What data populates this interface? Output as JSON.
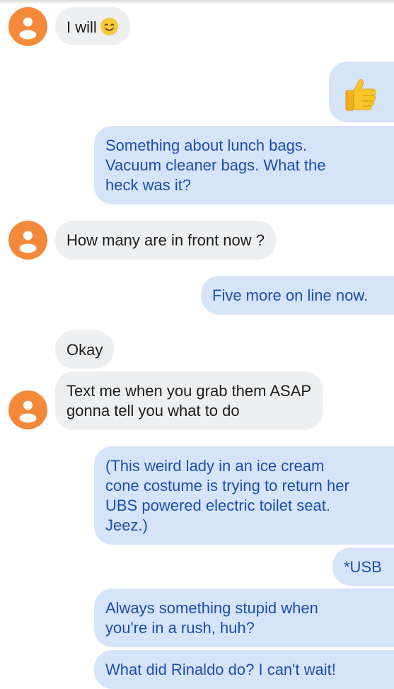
{
  "conversation": {
    "messages": [
      {
        "sender": "them",
        "text": "I will",
        "emoji": "smiling-face"
      },
      {
        "sender": "me",
        "emoji": "thumbs-up"
      },
      {
        "sender": "me",
        "lines": [
          "Something about lunch bags.",
          "Vacuum cleaner bags.  What the",
          "heck was it?"
        ]
      },
      {
        "sender": "them",
        "text": "How many are in front now ?"
      },
      {
        "sender": "me",
        "text": "Five more on line now."
      },
      {
        "sender": "them",
        "text": "Okay"
      },
      {
        "sender": "them",
        "lines": [
          "Text me when you grab them ASAP",
          "gonna tell you what to do"
        ]
      },
      {
        "sender": "me",
        "lines": [
          "(This weird lady in an ice cream",
          "cone costume is trying to return her",
          "UBS powered electric toilet seat.",
          "Jeez.)"
        ]
      },
      {
        "sender": "me",
        "text": "*USB"
      },
      {
        "sender": "me",
        "lines": [
          "Always something stupid when",
          "you're in a rush, huh?"
        ]
      },
      {
        "sender": "me",
        "text": "What did Rinaldo do?  I can't wait!"
      }
    ]
  },
  "colors": {
    "avatar": "#f5893b",
    "incoming_bubble": "#eeeff1",
    "outgoing_bubble": "#d6e4fa",
    "outgoing_text": "#1b4fad"
  }
}
